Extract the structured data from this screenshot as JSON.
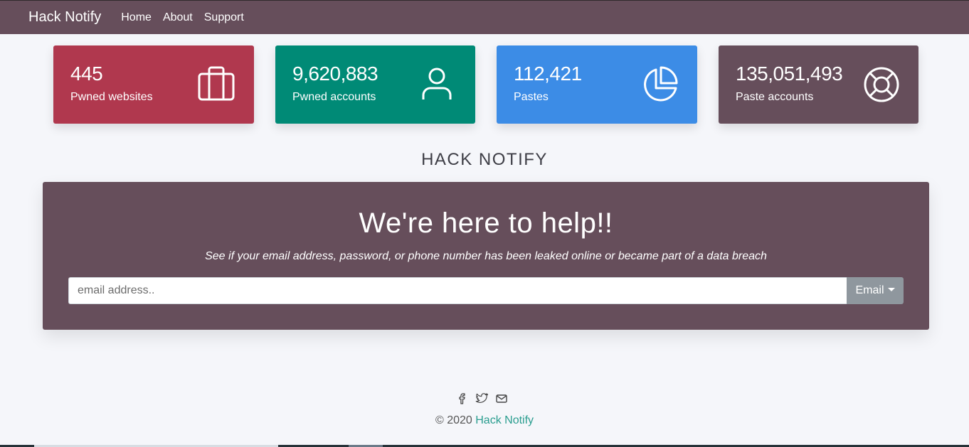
{
  "nav": {
    "brand": "Hack Notify",
    "links": [
      "Home",
      "About",
      "Support"
    ]
  },
  "stats": [
    {
      "value": "445",
      "label": "Pwned websites",
      "icon": "briefcase-icon",
      "color": "#b0384e"
    },
    {
      "value": "9,620,883",
      "label": "Pwned accounts",
      "icon": "user-icon",
      "color": "#008a76"
    },
    {
      "value": "112,421",
      "label": "Pastes",
      "icon": "pie-chart-icon",
      "color": "#3c8ce6"
    },
    {
      "value": "135,051,493",
      "label": "Paste accounts",
      "icon": "life-buoy-icon",
      "color": "#664e5b"
    }
  ],
  "section_title": "HACK NOTIFY",
  "hero": {
    "title": "We're here to help!!",
    "subtitle": "See if your email address, password, or phone number has been leaked online or became part of a data breach",
    "input_placeholder": "email address..",
    "input_value": "",
    "type_selected": "Email"
  },
  "social_icons": [
    "facebook-icon",
    "twitter-icon",
    "mail-icon"
  ],
  "footer": {
    "copyright": "© 2020",
    "brand": "Hack Notify"
  },
  "colors": {
    "nav_bg": "#664e5b",
    "accent_link": "#2a9d8f"
  }
}
